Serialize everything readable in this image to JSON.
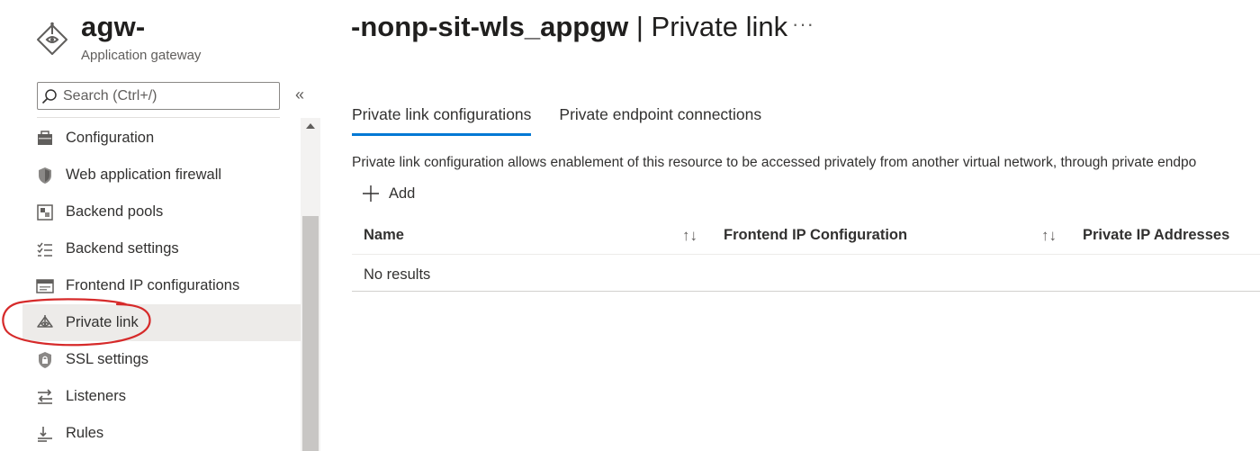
{
  "header": {
    "title_prefix": "agw-",
    "title_suffix_resource": "-nonp-sit-wls_appgw",
    "title_separator_page": " | Private link",
    "subtitle": "Application gateway",
    "more_label": "···",
    "icon": "application-gateway-icon"
  },
  "search": {
    "placeholder": "Search (Ctrl+/)",
    "collapse_label": "«"
  },
  "sidebar": {
    "items": [
      {
        "label": "Configuration",
        "icon": "configuration-icon"
      },
      {
        "label": "Web application firewall",
        "icon": "shield-icon"
      },
      {
        "label": "Backend pools",
        "icon": "backend-pools-icon"
      },
      {
        "label": "Backend settings",
        "icon": "backend-settings-icon"
      },
      {
        "label": "Frontend IP configurations",
        "icon": "frontend-ip-icon"
      },
      {
        "label": "Private link",
        "icon": "private-link-icon",
        "selected": true
      },
      {
        "label": "SSL settings",
        "icon": "ssl-shield-icon"
      },
      {
        "label": "Listeners",
        "icon": "listeners-icon"
      },
      {
        "label": "Rules",
        "icon": "rules-icon"
      }
    ]
  },
  "main": {
    "tabs": [
      {
        "label": "Private link configurations",
        "active": true
      },
      {
        "label": "Private endpoint connections",
        "active": false
      }
    ],
    "description": "Private link configuration allows enablement of this resource to be accessed privately from another virtual network, through private endpo",
    "add_label": "Add",
    "columns": [
      "Name",
      "Frontend IP Configuration",
      "Private IP Addresses"
    ],
    "sort_icon": "↑↓",
    "empty_text": "No results"
  },
  "colors": {
    "accent": "#0078d4",
    "annotation": "#d62a2a",
    "selected_bg": "#edebe9"
  }
}
